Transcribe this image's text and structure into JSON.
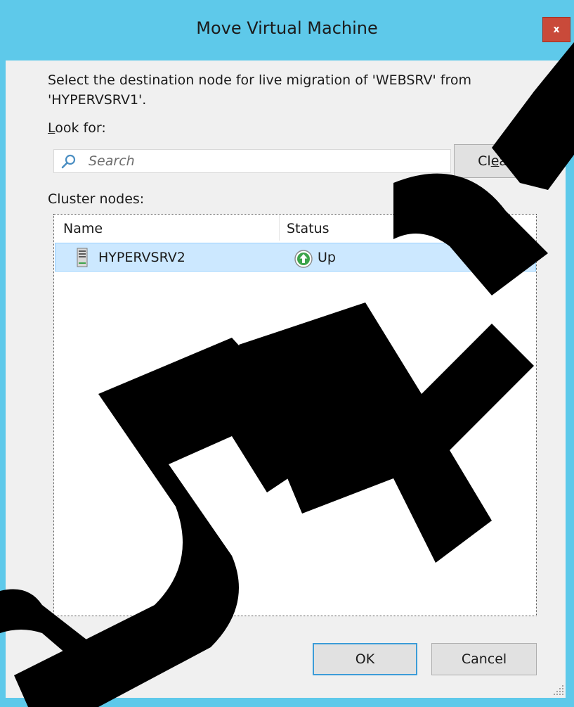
{
  "dialog": {
    "title": "Move Virtual Machine",
    "close_label": "x",
    "prompt": "Select the destination node for live migration of 'WEBSRV' from 'HYPERVSRV1'.",
    "look_for_label": "Look for:",
    "search_placeholder": "Search",
    "clear_label": "Clear",
    "cluster_nodes_label": "Cluster nodes:",
    "columns": [
      "Name",
      "Status"
    ],
    "nodes": [
      {
        "name": "HYPERVSRV2",
        "status": "Up",
        "status_icon": "up-arrow-icon"
      }
    ],
    "ok_label": "OK",
    "cancel_label": "Cancel"
  },
  "watermark": {
    "text": "COPYRIGHT"
  },
  "colors": {
    "frame": "#5ec9ea",
    "close_button": "#c94a3a",
    "selection": "#cce8ff",
    "status_up": "#3ca34a"
  }
}
